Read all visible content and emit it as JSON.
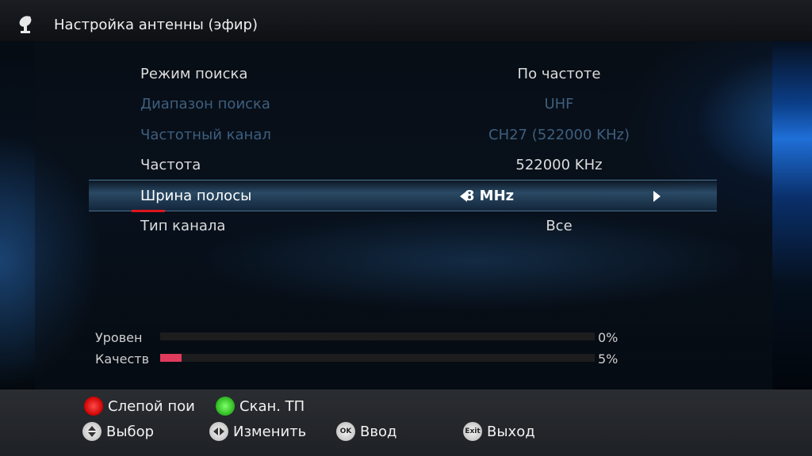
{
  "header": {
    "title": "Настройка антенны (эфир)",
    "icon": "satellite-dish-icon"
  },
  "settings": [
    {
      "label": "Режим поиска",
      "value": "По частоте",
      "state": "normal"
    },
    {
      "label": "Диапазон поиска",
      "value": "UHF",
      "state": "disabled"
    },
    {
      "label": "Частотный канал",
      "value": "CH27 (522000 KHz)",
      "state": "disabled"
    },
    {
      "label": "Частота",
      "value": "522000 KHz",
      "state": "normal"
    },
    {
      "label": "Шрина полосы",
      "value": "8 MHz",
      "state": "selected"
    },
    {
      "label": "Тип канала",
      "value": "Все",
      "state": "normal"
    }
  ],
  "meters": {
    "level": {
      "label": "Уровен",
      "percent": 0,
      "percent_text": "0%"
    },
    "quality": {
      "label": "Качеств",
      "percent": 5,
      "percent_text": "5%"
    }
  },
  "footer": {
    "red_label": "Слепой пои",
    "green_label": "Скан. ТП",
    "select_label": "Выбор",
    "change_label": "Изменить",
    "ok_label": "Ввод",
    "ok_icon_text": "OK",
    "exit_label": "Выход",
    "exit_icon_text": "Exit"
  },
  "colors": {
    "accent_red": "#e0141e",
    "meter_fill": "#e03a5c",
    "disabled_text": "#3e5f7f",
    "highlight_glow": "#1f6fd8"
  }
}
